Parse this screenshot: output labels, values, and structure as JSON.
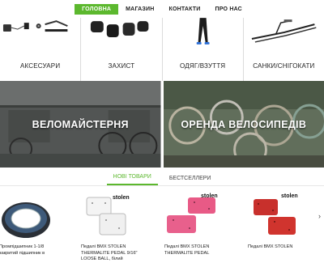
{
  "nav": {
    "items": [
      {
        "label": "ГОЛОВНА",
        "active": true
      },
      {
        "label": "МАГАЗИН",
        "active": false
      },
      {
        "label": "КОНТАКТИ",
        "active": false
      },
      {
        "label": "ПРО НАС",
        "active": false
      }
    ],
    "accent_color": "#5cb82e"
  },
  "categories": [
    {
      "label": "АКСЕСУАРИ",
      "icon": "accessories-image"
    },
    {
      "label": "ЗАХИСТ",
      "icon": "protection-image"
    },
    {
      "label": "ОДЯГ/ВЗУТТЯ",
      "icon": "clothing-image"
    },
    {
      "label": "САНКИ/СНІГОКАТИ",
      "icon": "sled-image"
    }
  ],
  "banners": [
    {
      "title": "ВЕЛОМАЙСТЕРНЯ"
    },
    {
      "title": "ОРЕНДА ВЕЛОСИПЕДІВ"
    }
  ],
  "tabs": [
    {
      "label": "НОВІ ТОВАРИ",
      "active": true
    },
    {
      "label": "БЕСТСЕЛЛЕРИ",
      "active": false
    }
  ],
  "products": [
    {
      "name": "Промпідшипник 1-1/8 закритий підшипник в",
      "image": "bearing-image"
    },
    {
      "name": "Педалі BMX STOLEN THERMALITE PEDAL 9/16\" LOOSE BALL, білий",
      "image": "pedals-white-image"
    },
    {
      "name": "Педалі BMX STOLEN THERMALITE PEDAL",
      "image": "pedals-pink-image"
    },
    {
      "name": "Педалі BMX STOLEN",
      "image": "pedals-red-image"
    }
  ],
  "carousel_next_icon": "chevron-right-icon"
}
